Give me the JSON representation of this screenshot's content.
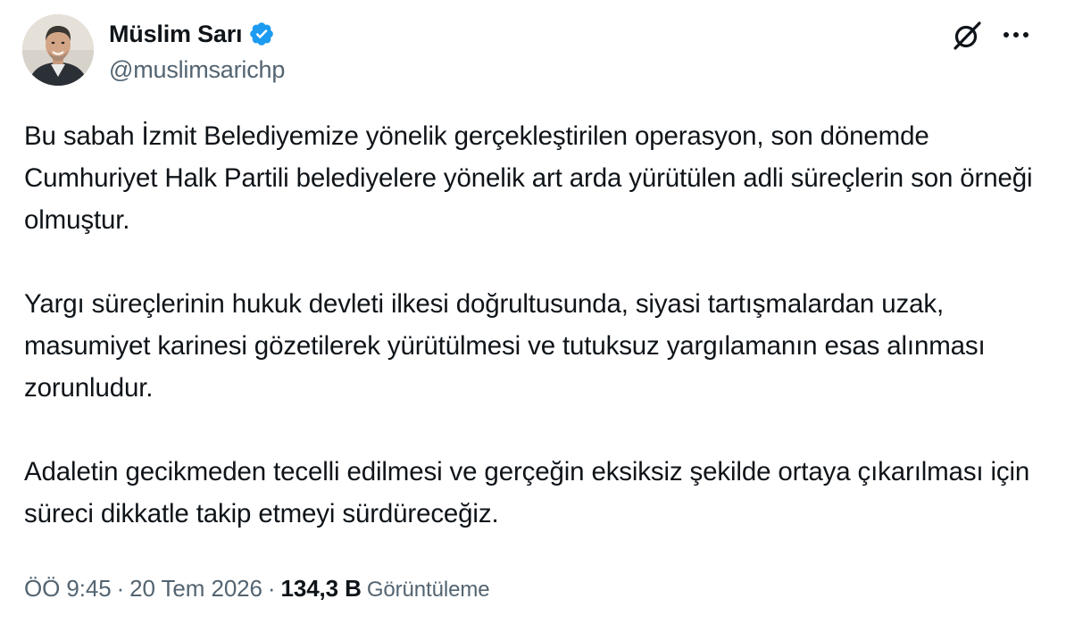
{
  "author": {
    "display_name": "Müslim Sarı",
    "handle": "@muslimsarichp",
    "verified": true,
    "verified_color": "#1d9bf0"
  },
  "icons": {
    "grok": "grok-icon",
    "more": "more-horizontal-icon",
    "verified": "verified-badge-icon"
  },
  "tweet": {
    "paragraphs": [
      "Bu sabah İzmit Belediyemize yönelik gerçekleştirilen operasyon, son dönemde Cumhuriyet Halk Partili belediyelere yönelik art arda yürütülen adli süreçlerin son örneği olmuştur.",
      "Yargı süreçlerinin hukuk devleti ilkesi doğrultusunda, siyasi tartışmalardan uzak, masumiyet karinesi gözetilerek yürütülmesi ve tutuksuz yargılamanın esas alınması zorunludur.",
      "Adaletin gecikmeden tecelli edilmesi ve gerçeğin eksiksiz şekilde ortaya çıkarılması için süreci dikkatle takip etmeyi sürdüreceğiz."
    ],
    "time": "ÖÖ 9:45",
    "date": "20 Tem 2026",
    "separator": "·",
    "views_count": "134,3 B",
    "views_label": "Görüntüleme"
  }
}
